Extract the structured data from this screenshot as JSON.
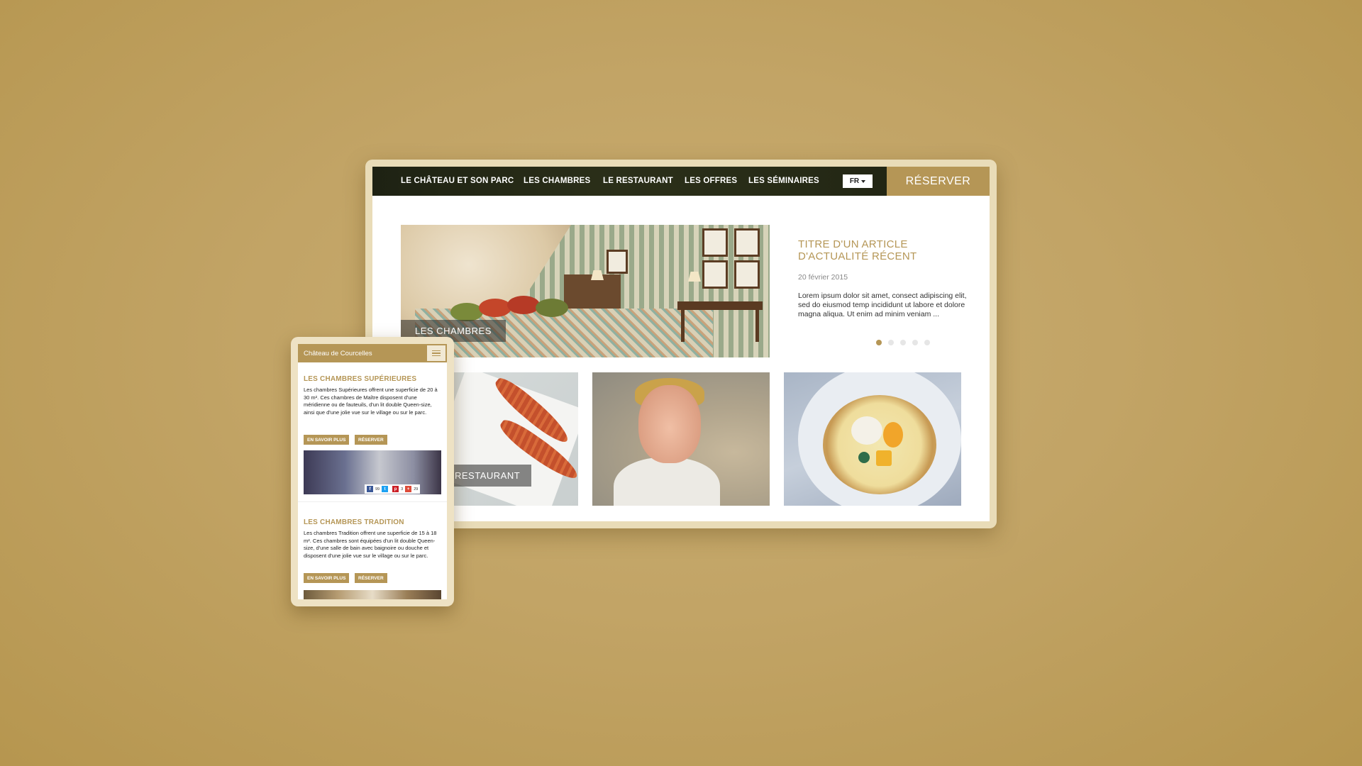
{
  "desktop": {
    "nav": {
      "items": [
        "LE CHÂTEAU ET SON PARC",
        "LES CHAMBRES",
        "LE RESTAURANT",
        "LES OFFRES",
        "LES SÉMINAIRES"
      ],
      "language": "FR",
      "reserve_label": "RÉSERVER"
    },
    "tiles": {
      "rooms_label": "LES CHAMBRES",
      "restaurant_label": "RESTAURANT"
    },
    "article": {
      "title": "TITRE D'UN ARTICLE D'ACTUALITÉ RÉCENT",
      "date": "20 février 2015",
      "body": "Lorem ipsum dolor sit amet, consect adipiscing elit, sed do eiusmod temp incididunt ut labore et dolore magna aliqua. Ut enim ad minim veniam ..."
    },
    "carousel": {
      "count": 5,
      "active": 1
    }
  },
  "mobile": {
    "header_title": "Château de Courcelles",
    "sections": [
      {
        "title": "LES CHAMBRES SUPÉRIEURES",
        "body": "Les chambres Supérieures offrent une superficie de 20 à 30 m². Ces chambres de Maître disposent d'une méridienne ou de fauteuils, d'un lit double Queen-size, ainsi que d'une jolie vue sur le village ou sur le parc.",
        "more_label": "EN SAVOIR PLUS",
        "reserve_label": "RÉSERVER"
      },
      {
        "title": "LES CHAMBRES TRADITION",
        "body": "Les chambres Tradition offrent une superficie de 15 à 18 m². Ces chambres sont équipées d'un lit double Queen-size, d'une salle de bain avec baignoire ou douche et disposent d'une jolie vue sur le village ou sur le parc.",
        "more_label": "EN SAVOIR PLUS",
        "reserve_label": "RÉSERVER"
      }
    ],
    "share": {
      "facebook_count": "99",
      "twitter_count": "",
      "pinterest_count": "3",
      "google_count": "29"
    }
  },
  "colors": {
    "accent": "#b59656",
    "background": "#c2a466",
    "nav_dark": "#262a16"
  },
  "icons": [
    "hamburger-menu-icon",
    "caret-down-icon",
    "facebook-icon",
    "twitter-icon",
    "pinterest-icon",
    "google-plus-icon"
  ]
}
